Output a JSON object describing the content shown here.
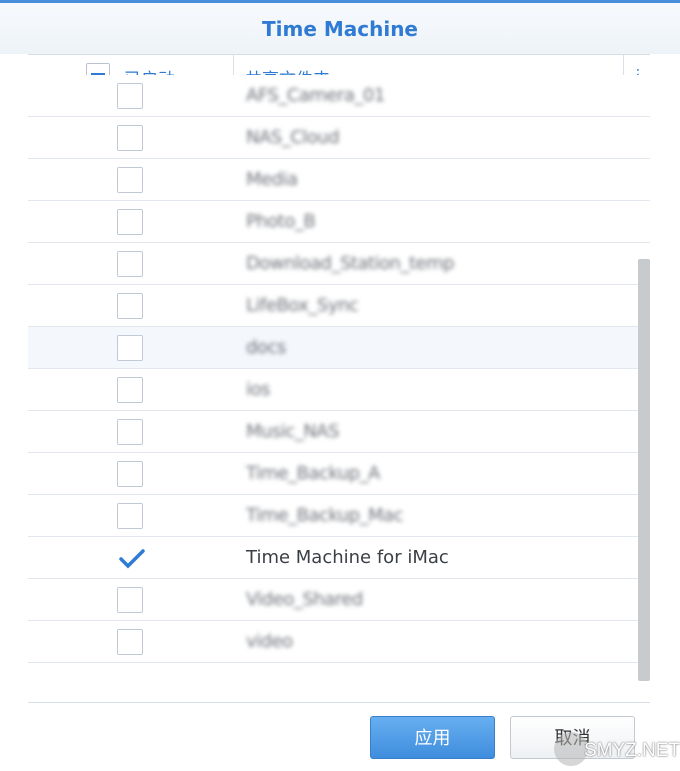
{
  "dialog": {
    "title": "Time Machine"
  },
  "table": {
    "columns": {
      "enabled": "已启动",
      "shared_folder": "共享文件夹"
    },
    "menu_icon": "more-vertical-icon",
    "rows": [
      {
        "name": "AFS_Camera_01",
        "checked": false,
        "blurred": true
      },
      {
        "name": "NAS_Cloud",
        "checked": false,
        "blurred": true
      },
      {
        "name": "Media",
        "checked": false,
        "blurred": true
      },
      {
        "name": "Photo_B",
        "checked": false,
        "blurred": true
      },
      {
        "name": "Download_Station_temp",
        "checked": false,
        "blurred": true
      },
      {
        "name": "LifeBox_Sync",
        "checked": false,
        "blurred": true
      },
      {
        "name": "docs",
        "checked": false,
        "blurred": true
      },
      {
        "name": "ios",
        "checked": false,
        "blurred": true
      },
      {
        "name": "Music_NAS",
        "checked": false,
        "blurred": true
      },
      {
        "name": "Time_Backup_A",
        "checked": false,
        "blurred": true
      },
      {
        "name": "Time_Backup_Mac",
        "checked": false,
        "blurred": true
      },
      {
        "name": "Time Machine for iMac",
        "checked": true,
        "blurred": false
      },
      {
        "name": "Video_Shared",
        "checked": false,
        "blurred": true
      },
      {
        "name": "video",
        "checked": false,
        "blurred": true
      }
    ]
  },
  "buttons": {
    "apply": "应用",
    "cancel": "取消"
  },
  "watermark": {
    "text": "SMYZ.NET"
  },
  "colors": {
    "accent": "#2f7bd3",
    "apply_button": "#4a95e2"
  }
}
